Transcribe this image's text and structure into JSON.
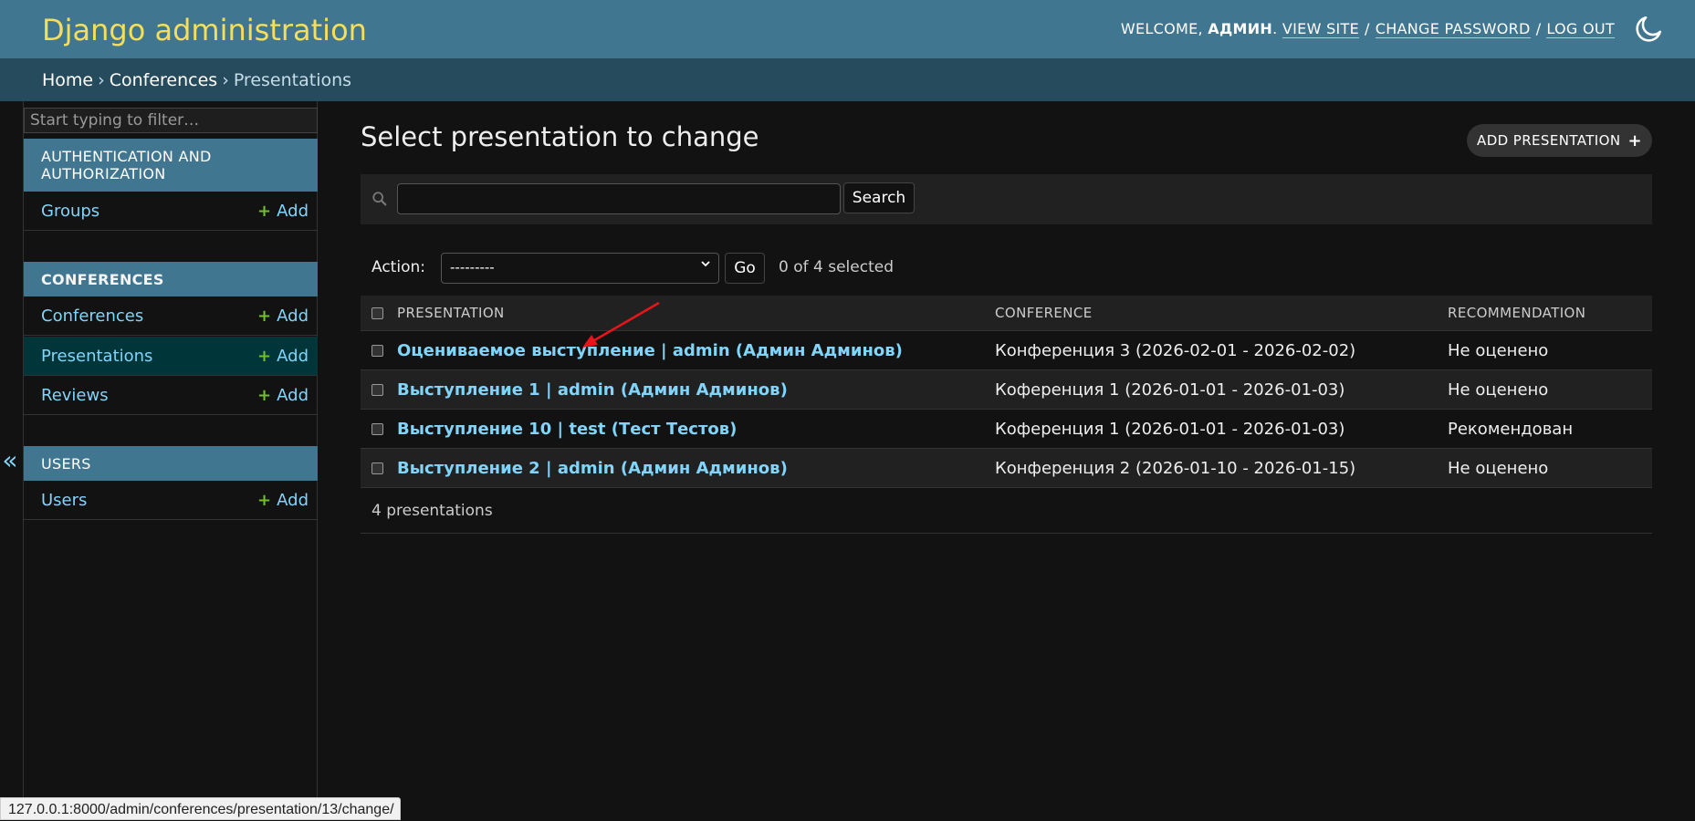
{
  "header": {
    "site_name": "Django administration",
    "welcome": "WELCOME,",
    "username": "АДМИН",
    "view_site": "VIEW SITE",
    "change_password": "CHANGE PASSWORD",
    "log_out": "LOG OUT",
    "bg_color": "#417690",
    "brand_color": "#f5dd5d"
  },
  "breadcrumbs": {
    "home": "Home",
    "app": "Conferences",
    "current": "Presentations"
  },
  "sidebar": {
    "filter_placeholder": "Start typing to filter…",
    "toggle_label": "«",
    "apps": [
      {
        "caption": "AUTHENTICATION AND AUTHORIZATION",
        "models": [
          {
            "label": "Groups",
            "add": "Add"
          }
        ]
      },
      {
        "caption": "CONFERENCES",
        "models": [
          {
            "label": "Conferences",
            "add": "Add"
          },
          {
            "label": "Presentations",
            "add": "Add",
            "current": true
          },
          {
            "label": "Reviews",
            "add": "Add"
          }
        ]
      },
      {
        "caption": "USERS",
        "models": [
          {
            "label": "Users",
            "add": "Add"
          }
        ]
      }
    ]
  },
  "main": {
    "title": "Select presentation to change",
    "add_button": "ADD PRESENTATION",
    "search": {
      "value": "",
      "button": "Search"
    },
    "actions": {
      "label": "Action:",
      "selected_option": "---------",
      "go": "Go",
      "counter": "0 of 4 selected"
    },
    "table": {
      "headers": [
        "PRESENTATION",
        "CONFERENCE",
        "RECOMMENDATION"
      ],
      "rows": [
        {
          "presentation": "Оцениваемое выступление | admin (Админ Админов)",
          "conference": "Конференция 3 (2026-02-01 - 2026-02-02)",
          "recommendation": "Не оценено"
        },
        {
          "presentation": "Выступление 1 | admin (Админ Админов)",
          "conference": "Коференция 1 (2026-01-01 - 2026-01-03)",
          "recommendation": "Не оценено"
        },
        {
          "presentation": "Выступление 10 | test (Тест Тестов)",
          "conference": "Коференция 1 (2026-01-01 - 2026-01-03)",
          "recommendation": "Рекомендован"
        },
        {
          "presentation": "Выступление 2 | admin (Админ Админов)",
          "conference": "Конференция 2 (2026-01-10 - 2026-01-15)",
          "recommendation": "Не оценено"
        }
      ]
    },
    "paginator": "4 presentations"
  },
  "status_bar": {
    "url": "127.0.0.1:8000/admin/conferences/presentation/13/change/"
  },
  "colors": {
    "link": "#81d4fa",
    "add_plus": "#70bf2b",
    "annotation_arrow": "#e8141b"
  }
}
